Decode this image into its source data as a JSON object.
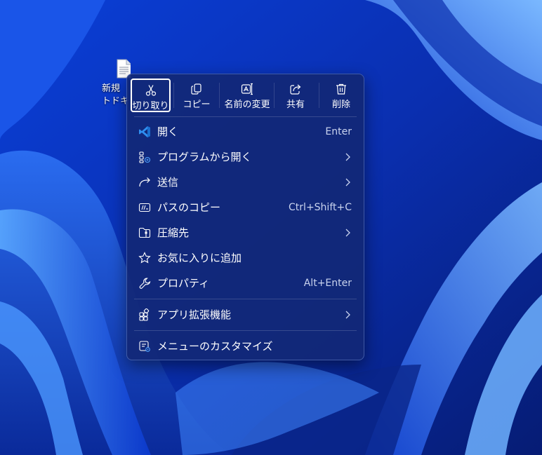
{
  "desktop": {
    "file_icon": {
      "name": "text-file-icon",
      "label": "新規\nトドキ"
    }
  },
  "colors": {
    "accent": "#4fa3ff",
    "menu_bg": "#12287a",
    "text": "#ffffff",
    "secondary_text": "#c9d3ee"
  },
  "toolbar": {
    "items": [
      {
        "label": "切り取り",
        "icon": "scissors-icon"
      },
      {
        "label": "コピー",
        "icon": "copy-icon"
      },
      {
        "label": "名前の変更",
        "icon": "rename-icon"
      },
      {
        "label": "共有",
        "icon": "share-icon"
      },
      {
        "label": "削除",
        "icon": "trash-icon"
      }
    ]
  },
  "menu": {
    "items": [
      {
        "label": "開く",
        "shortcut": "Enter",
        "icon": "vscode-icon"
      },
      {
        "label": "プログラムから開く",
        "icon": "open-with-icon",
        "submenu": true
      },
      {
        "label": "送信",
        "icon": "send-arrow-icon",
        "submenu": true
      },
      {
        "label": "パスのコピー",
        "shortcut": "Ctrl+Shift+C",
        "icon": "copy-path-icon"
      },
      {
        "label": "圧縮先",
        "icon": "zip-folder-icon",
        "submenu": true
      },
      {
        "label": "お気に入りに追加",
        "icon": "star-icon"
      },
      {
        "label": "プロパティ",
        "shortcut": "Alt+Enter",
        "icon": "wrench-icon"
      }
    ],
    "extensions": {
      "label": "アプリ拡張機能",
      "icon": "extensions-icon",
      "submenu": true
    },
    "customize": {
      "label": "メニューのカスタマイズ",
      "icon": "customize-icon"
    }
  }
}
